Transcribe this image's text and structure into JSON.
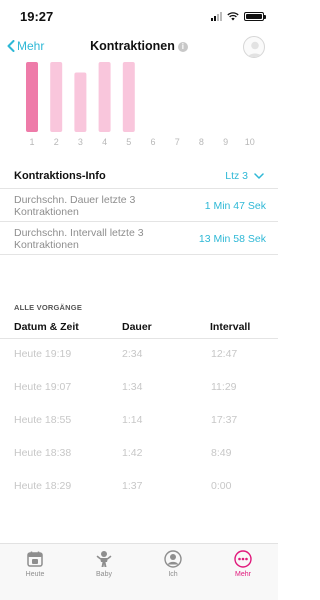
{
  "status": {
    "time": "19:27"
  },
  "nav": {
    "back_label": "Mehr",
    "title": "Kontraktionen"
  },
  "chart_data": {
    "type": "bar",
    "categories": [
      "1",
      "2",
      "3",
      "4",
      "5",
      "6",
      "7",
      "8",
      "9",
      "10"
    ],
    "values": [
      1.0,
      1.0,
      0.85,
      1.0,
      1.0,
      null,
      null,
      null,
      null,
      null
    ],
    "highlight_index": 0,
    "colors": {
      "highlight": "#ee7ba9",
      "normal": "#f9c6dc",
      "tick_label": "#b8b8b8"
    }
  },
  "contraction_info": {
    "title": "Kontraktions-Info",
    "selector": "Ltz 3",
    "stats": [
      {
        "label": "Durchschn. Dauer letzte 3 Kontraktionen",
        "value": "1 Min 47 Sek"
      },
      {
        "label": "Durchschn. Intervall letzte 3 Kontraktionen",
        "value": "13 Min 58 Sek"
      }
    ]
  },
  "history": {
    "section_label": "ALLE VORGÄNGE",
    "columns": [
      "Datum & Zeit",
      "Dauer",
      "Intervall"
    ],
    "rows": [
      {
        "date": "Heute 19:19",
        "duration": "2:34",
        "interval": "12:47"
      },
      {
        "date": "Heute 19:07",
        "duration": "1:34",
        "interval": "11:29"
      },
      {
        "date": "Heute 18:55",
        "duration": "1:14",
        "interval": "17:37"
      },
      {
        "date": "Heute 18:38",
        "duration": "1:42",
        "interval": "8:49"
      },
      {
        "date": "Heute 18:29",
        "duration": "1:37",
        "interval": "0:00"
      }
    ]
  },
  "tabs": [
    {
      "label": "Heute",
      "icon": "calendar-icon",
      "active": false
    },
    {
      "label": "Baby",
      "icon": "baby-icon",
      "active": false
    },
    {
      "label": "Ich",
      "icon": "person-icon",
      "active": false
    },
    {
      "label": "Mehr",
      "icon": "more-icon",
      "active": true
    }
  ],
  "colors": {
    "accent": "#2eb8d6",
    "active_tab": "#e0187b"
  }
}
